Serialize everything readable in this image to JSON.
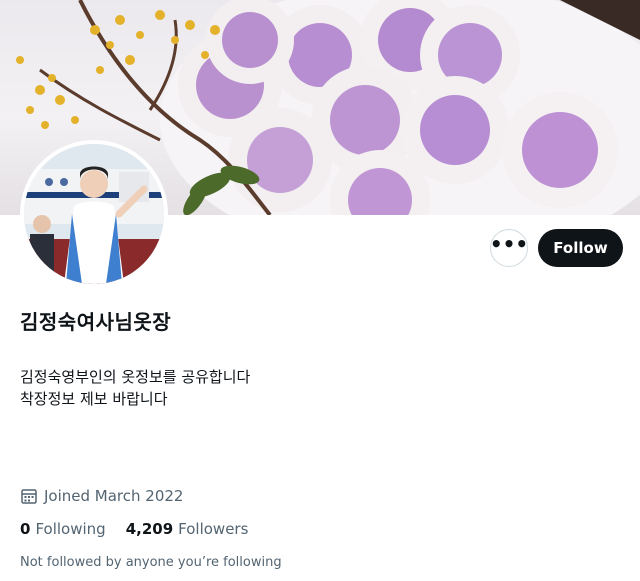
{
  "profile": {
    "display_name": "김정숙여사님옷장",
    "bio": "김정숙영부인의 옷정보를 공유합니다\n착장정보 제보 바랍니다",
    "joined": "Joined March 2022",
    "following_count": "0",
    "following_label": "Following",
    "followers_count": "4,209",
    "followers_label": "Followers",
    "not_followed_text": "Not followed by anyone you’re following"
  },
  "actions": {
    "more_label": "•••",
    "follow_label": "Follow"
  },
  "icons": {
    "more": "more-icon",
    "calendar": "calendar-icon"
  },
  "colors": {
    "follow_bg": "#0f1419",
    "muted_text": "#536471"
  }
}
